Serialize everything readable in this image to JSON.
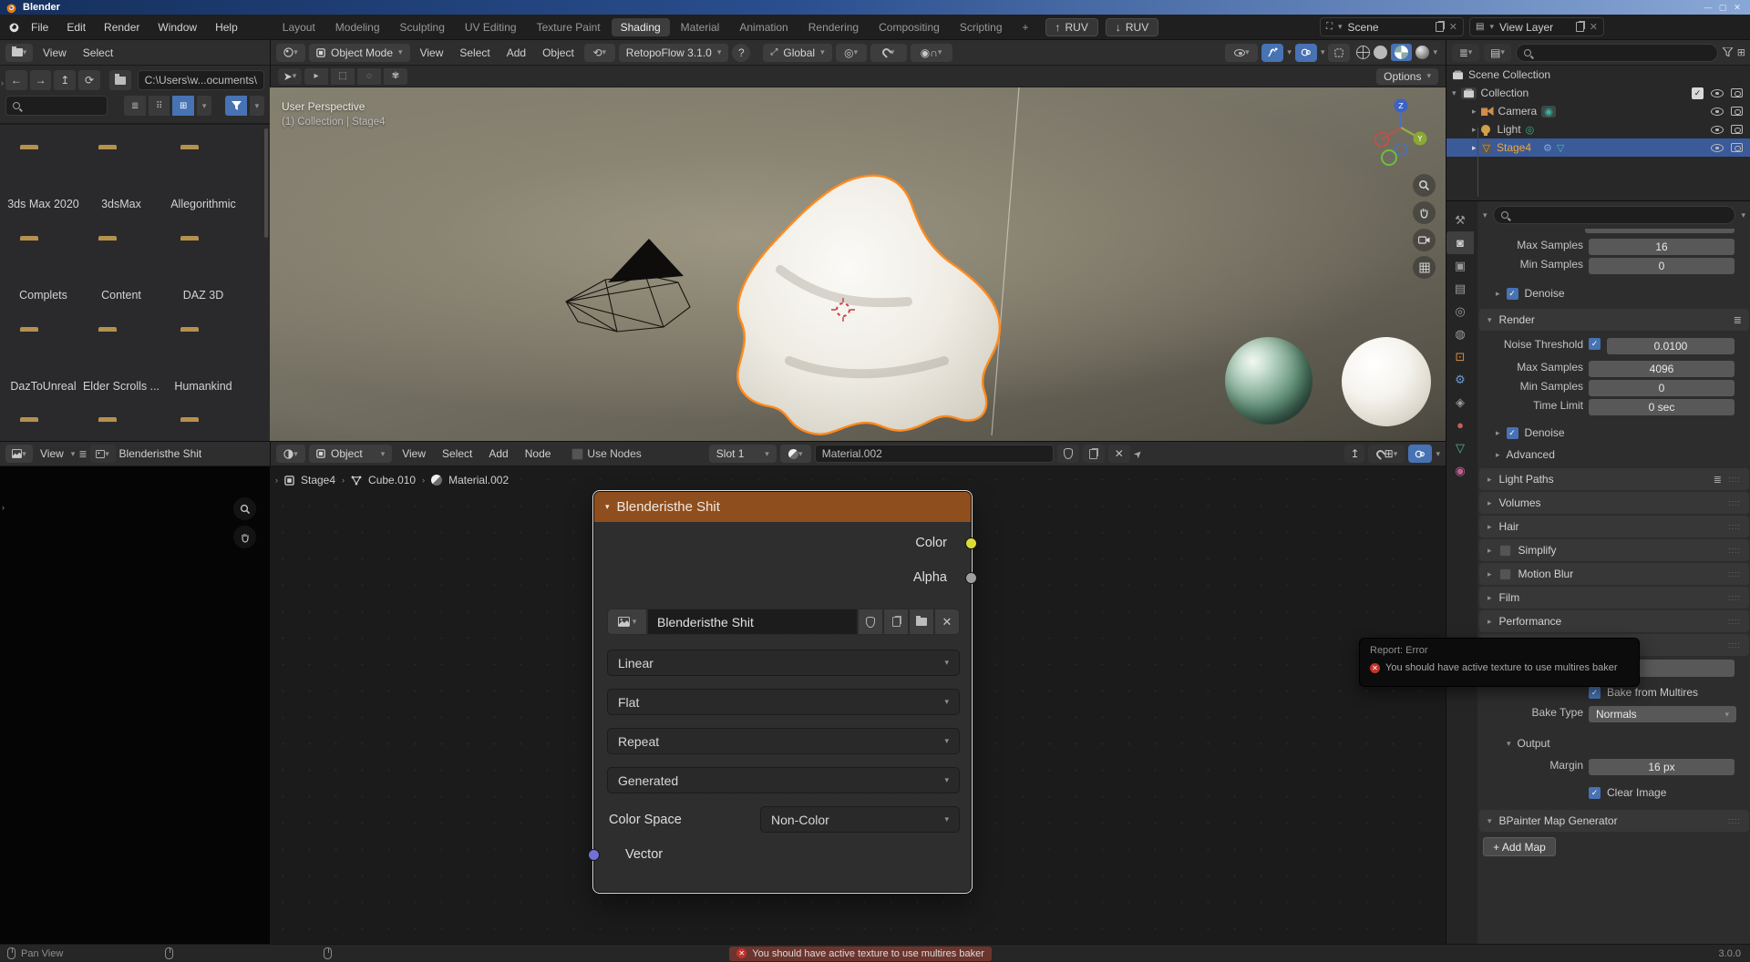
{
  "window": {
    "title": "Blender",
    "version": "3.0.0"
  },
  "menubar": {
    "menus": [
      "File",
      "Edit",
      "Render",
      "Window",
      "Help"
    ],
    "workspaces": [
      "Layout",
      "Modeling",
      "Sculpting",
      "UV Editing",
      "Texture Paint",
      "Shading",
      "Material",
      "Animation",
      "Rendering",
      "Compositing",
      "Scripting"
    ],
    "active_workspace": "Shading",
    "add_workspace": "+",
    "ruv_export": "RUV",
    "ruv_import": "RUV",
    "scene": "Scene",
    "view_layer": "View Layer"
  },
  "viewport": {
    "mode": "Object Mode",
    "menus": [
      "View",
      "Select",
      "Add",
      "Object"
    ],
    "addon": "RetopoFlow 3.1.0",
    "help": "?",
    "orientation": "Global",
    "options": "Options",
    "overlay_line1": "User Perspective",
    "overlay_line2": "(1) Collection | Stage4"
  },
  "file_browser": {
    "view": "View",
    "select": "Select",
    "path": "C:\\Users\\w...ocuments\\",
    "folders": [
      "3ds Max 2020",
      "3dsMax",
      "Allegorithmic",
      "Complets",
      "Content",
      "DAZ 3D",
      "DazToUnreal",
      "Elder Scrolls ...",
      "Humankind"
    ]
  },
  "image_editor": {
    "view": "View",
    "image": "Blenderisthe Shit"
  },
  "shader_editor": {
    "object": "Object",
    "menus": [
      "View",
      "Select",
      "Add",
      "Node"
    ],
    "use_nodes": "Use Nodes",
    "slot": "Slot 1",
    "material": "Material.002",
    "breadcrumb": [
      "Stage4",
      "Cube.010",
      "Material.002"
    ]
  },
  "node": {
    "title": "Blenderisthe Shit",
    "outputs": [
      "Color",
      "Alpha"
    ],
    "image": "Blenderisthe Shit",
    "interpolation": "Linear",
    "projection": "Flat",
    "extension": "Repeat",
    "source": "Generated",
    "color_space_label": "Color Space",
    "color_space": "Non-Color",
    "input": "Vector"
  },
  "outliner": {
    "scene_collection": "Scene Collection",
    "collection": "Collection",
    "camera": "Camera",
    "light": "Light",
    "stage": "Stage4"
  },
  "property_tabs": [
    {
      "name": "tool",
      "glyph": "⚒",
      "color": "#9a9a9a"
    },
    {
      "name": "render",
      "glyph": "◙",
      "color": "#d0d0d0"
    },
    {
      "name": "output",
      "glyph": "▣",
      "color": "#9a9a9a"
    },
    {
      "name": "view-layer",
      "glyph": "▤",
      "color": "#9a9a9a"
    },
    {
      "name": "scene",
      "glyph": "◎",
      "color": "#9a9a9a"
    },
    {
      "name": "world",
      "glyph": "◍",
      "color": "#9a9a9a"
    },
    {
      "name": "object",
      "glyph": "⊡",
      "color": "#d88a3f"
    },
    {
      "name": "modifiers",
      "glyph": "⚙",
      "color": "#6f9ad1"
    },
    {
      "name": "particles",
      "glyph": "◈",
      "color": "#9a9a9a"
    },
    {
      "name": "physics",
      "glyph": "●",
      "color": "#c85c5c"
    },
    {
      "name": "object-data",
      "glyph": "▽",
      "color": "#52b788"
    },
    {
      "name": "material",
      "glyph": "◉",
      "color": "#c06090"
    }
  ],
  "properties": {
    "max_samples_label": "Max Samples",
    "max_samples": "16",
    "min_samples_label": "Min Samples",
    "min_samples": "0",
    "denoise": "Denoise",
    "render_section": "Render",
    "noise_threshold_label": "Noise Threshold",
    "noise_threshold": "0.0100",
    "render_max_samples_label": "Max Samples",
    "render_max_samples": "4096",
    "render_min_samples_label": "Min Samples",
    "render_min_samples": "0",
    "time_limit_label": "Time Limit",
    "time_limit": "0 sec",
    "denoise2": "Denoise",
    "advanced": "Advanced",
    "sections": [
      "Light Paths",
      "Volumes",
      "Hair",
      "Simplify",
      "Motion Blur",
      "Film",
      "Performance"
    ],
    "bake_from_multires": "Bake from Multires",
    "bake_type_label": "Bake Type",
    "bake_type": "Normals",
    "output_section": "Output",
    "margin_label": "Margin",
    "margin": "16 px",
    "clear_image": "Clear Image",
    "bpainter_section": "BPainter Map Generator",
    "add_map": "+ Add Map"
  },
  "tooltip": {
    "title": "Report: Error",
    "message": "You should have active texture to use multires baker"
  },
  "status": {
    "left": "Pan View",
    "error": "You should have active texture to use multires baker",
    "version": "3.0.0"
  },
  "colors": {
    "accent_blue": "#4772b3",
    "node_header": "#8f4e1d",
    "selection_orange": "#ff8a1e",
    "error_red": "#c3322b"
  }
}
